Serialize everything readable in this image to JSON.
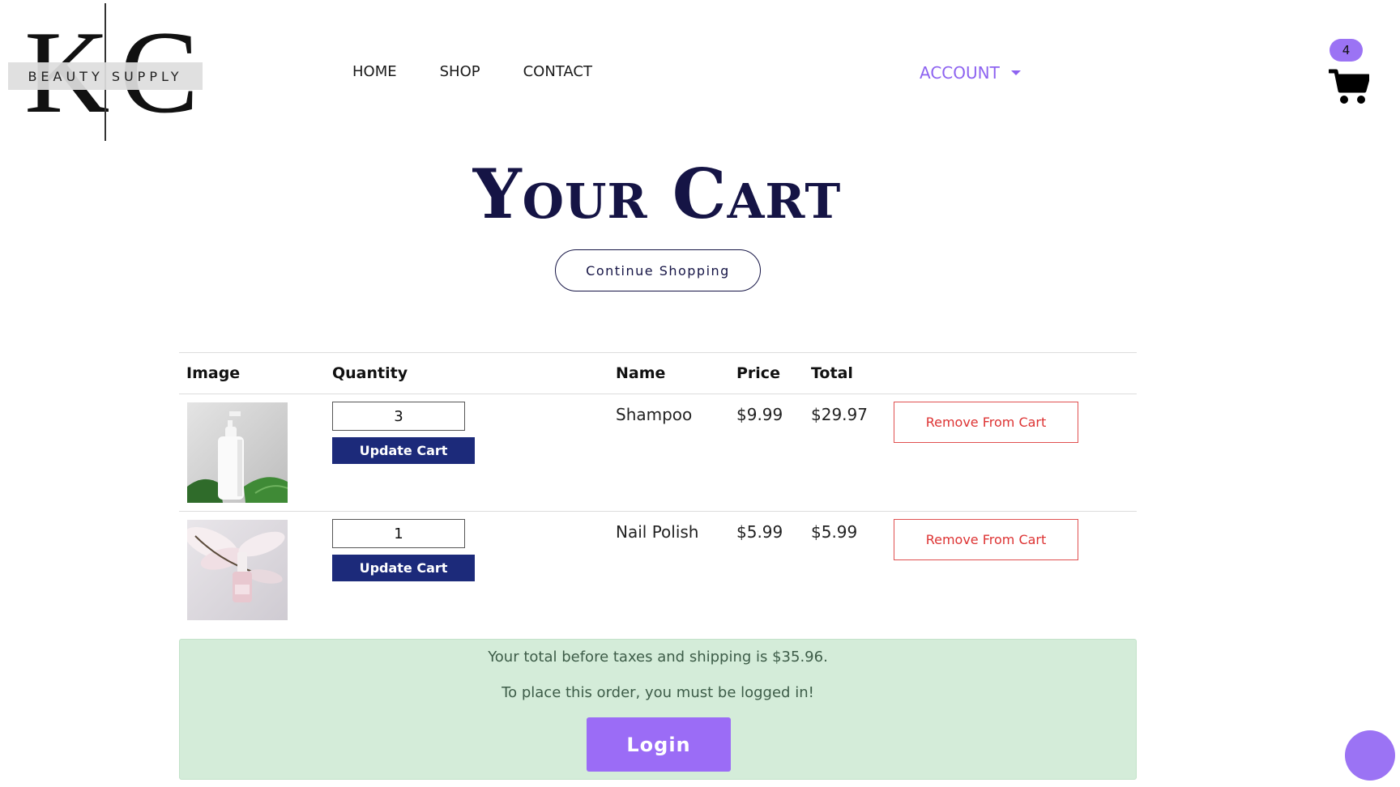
{
  "brand": {
    "logo_letters": "KC",
    "logo_tagline": "BEAUTY SUPPLY"
  },
  "nav": {
    "items": [
      "HOME",
      "SHOP",
      "CONTACT"
    ],
    "account_label": "ACCOUNT",
    "cart_count": "4"
  },
  "page": {
    "title": "Your Cart",
    "continue_label": "Continue Shopping"
  },
  "table": {
    "headers": {
      "image": "Image",
      "quantity": "Quantity",
      "name": "Name",
      "price": "Price",
      "total": "Total"
    },
    "rows": [
      {
        "quantity": "3",
        "update_label": "Update Cart",
        "name": "Shampoo",
        "price": "$9.99",
        "total": "$29.97",
        "remove_label": "Remove From Cart",
        "image_icon": "shampoo-bottle-image"
      },
      {
        "quantity": "1",
        "update_label": "Update Cart",
        "name": "Nail Polish",
        "price": "$5.99",
        "total": "$5.99",
        "remove_label": "Remove From Cart",
        "image_icon": "nail-polish-image"
      }
    ]
  },
  "summary": {
    "total_text": "Your total before taxes and shipping is $35.96.",
    "login_notice": "To place this order, you must be logged in!",
    "login_label": "Login"
  },
  "colors": {
    "accent_purple": "#9b6cf6",
    "title_navy": "#151445",
    "button_navy": "#1c2a7a",
    "remove_red": "#dd3333",
    "summary_green": "#d4ecd9"
  }
}
